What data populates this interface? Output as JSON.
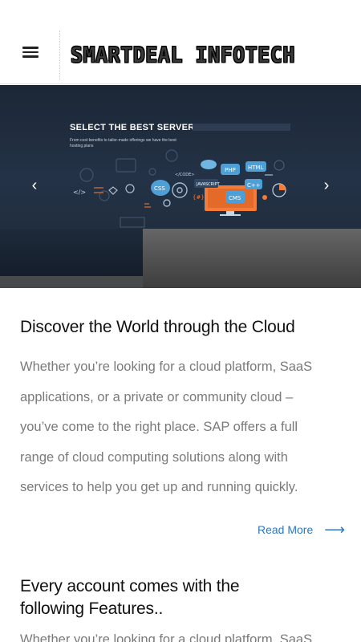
{
  "header": {
    "logo_text": "SMARTDEAL INFOTECH",
    "menu_icon": "hamburger-menu-icon"
  },
  "hero": {
    "slide_title": "SELECT THE BEST SERVER",
    "slide_subtitle": "From cost benefits to tailor-made offerings we have the best hosting plans",
    "tech_labels": [
      "PHP",
      "HTML",
      "CSS",
      "CMS",
      "C++",
      "JAVASCRIPT",
      "</>",
      "{#}",
      "</CODE>"
    ],
    "prev_icon": "chevron-left-icon",
    "next_icon": "chevron-right-icon",
    "colors": {
      "bg_dark": "#1e2a39",
      "accent": "#f47b3a"
    }
  },
  "main": {
    "heading": "Discover the World through the Cloud",
    "paragraph_lines": [
      "Whether you’re looking for a cloud platform, SaaS",
      "applications, or a private or community cloud –",
      "you’ve come to the right place. SAP offers a full",
      "range of cloud computing solutions along with",
      "services to help you get up and running quickly."
    ],
    "read_more": "Read More",
    "read_more_arrow": "⟶",
    "features_heading_lines": [
      "Every account comes with the",
      "following Features.."
    ],
    "features_paragraph": "Whether you’re looking for a cloud platform, SaaS"
  },
  "colors": {
    "link": "#2e77bb",
    "body_text": "#7a7a7a",
    "heading": "#111111"
  }
}
